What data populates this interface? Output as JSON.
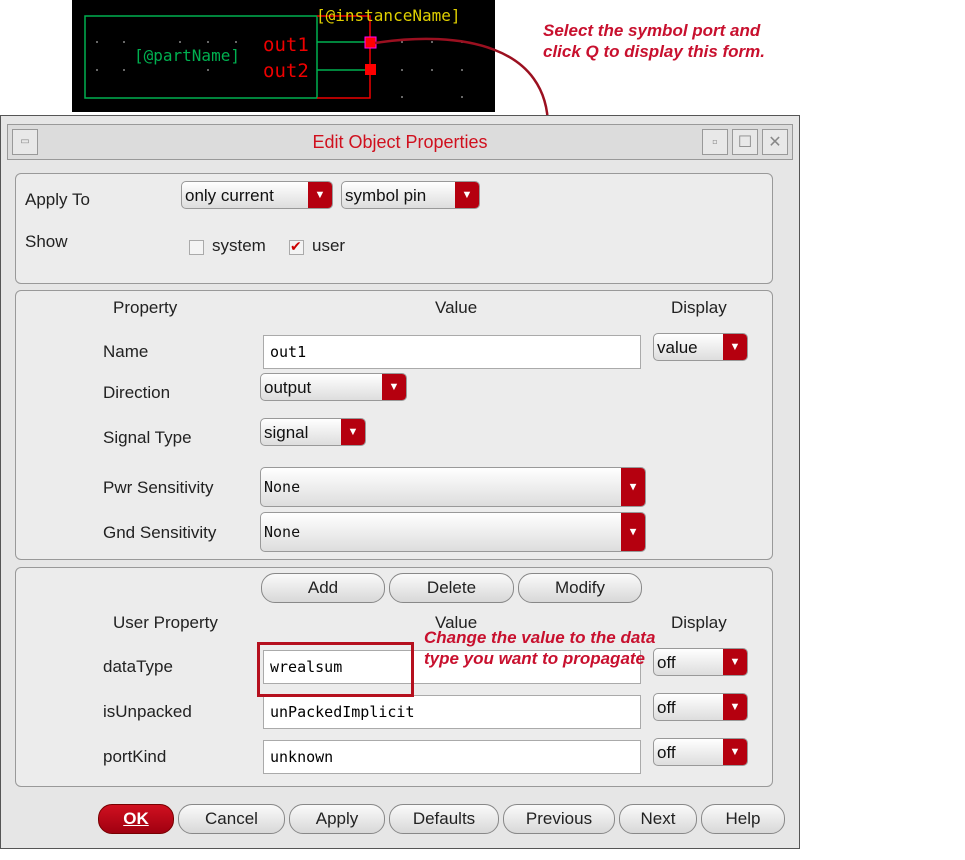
{
  "schematic": {
    "instance_label": "[@instanceName]",
    "part_label": "[@partName]",
    "pins": [
      "out1",
      "out2"
    ]
  },
  "annotations": {
    "top": "Select the symbol port and click Q to display this form.",
    "value": "Change the value to the data type you want to propagate"
  },
  "window": {
    "title": "Edit Object Properties"
  },
  "apply_to": {
    "label": "Apply To",
    "scope": "only current",
    "object": "symbol pin"
  },
  "show": {
    "label": "Show",
    "system": {
      "label": "system",
      "checked": false
    },
    "user": {
      "label": "user",
      "checked": true
    }
  },
  "props": {
    "headers": [
      "Property",
      "Value",
      "Display"
    ],
    "name": {
      "label": "Name",
      "value": "out1",
      "display": "value"
    },
    "direction": {
      "label": "Direction",
      "value": "output"
    },
    "signal_type": {
      "label": "Signal Type",
      "value": "signal"
    },
    "pwr": {
      "label": "Pwr Sensitivity",
      "value": "None"
    },
    "gnd": {
      "label": "Gnd Sensitivity",
      "value": "None"
    }
  },
  "user_props": {
    "buttons": [
      "Add",
      "Delete",
      "Modify"
    ],
    "headers": [
      "User Property",
      "Value",
      "Display"
    ],
    "rows": [
      {
        "name": "dataType",
        "value": "wrealsum",
        "display": "off"
      },
      {
        "name": "isUnpacked",
        "value": "unPackedImplicit",
        "display": "off"
      },
      {
        "name": "portKind",
        "value": "unknown",
        "display": "off"
      }
    ]
  },
  "footer": {
    "ok": "OK",
    "cancel": "Cancel",
    "apply": "Apply",
    "defaults": "Defaults",
    "previous": "Previous",
    "next": "Next",
    "help": "Help"
  },
  "colors": {
    "accent": "#b5000f",
    "title": "#d0101e"
  }
}
